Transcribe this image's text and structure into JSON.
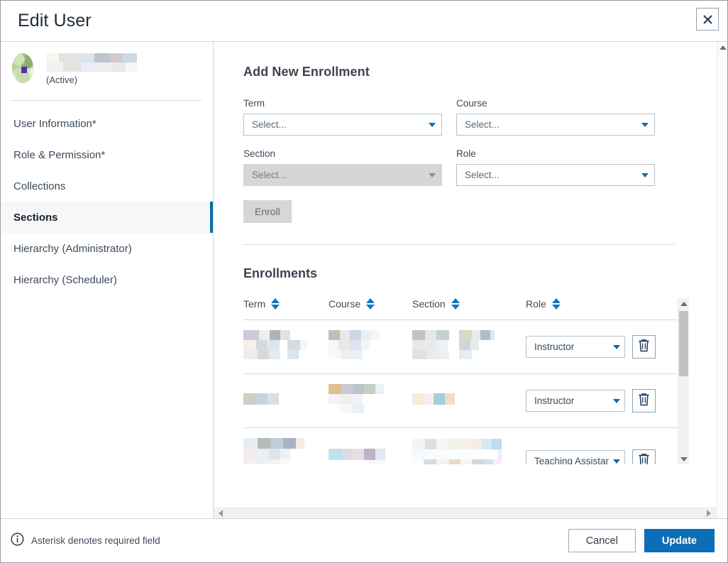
{
  "header": {
    "title": "Edit User",
    "close_label": "Close"
  },
  "sidebar": {
    "user": {
      "status": "(Active)",
      "name_redacted": true
    },
    "items": [
      {
        "label": "User Information*",
        "active": false
      },
      {
        "label": "Role & Permission*",
        "active": false
      },
      {
        "label": "Collections",
        "active": false
      },
      {
        "label": "Sections",
        "active": true
      },
      {
        "label": "Hierarchy (Administrator)",
        "active": false
      },
      {
        "label": "Hierarchy (Scheduler)",
        "active": false
      }
    ]
  },
  "main": {
    "add_enrollment": {
      "title": "Add New Enrollment",
      "fields": [
        {
          "label": "Term",
          "value": "Select...",
          "disabled": false
        },
        {
          "label": "Course",
          "value": "Select...",
          "disabled": false
        },
        {
          "label": "Section",
          "value": "Select...",
          "disabled": true
        },
        {
          "label": "Role",
          "value": "Select...",
          "disabled": false
        }
      ],
      "enroll_button": "Enroll"
    },
    "enrollments": {
      "title": "Enrollments",
      "columns": [
        {
          "label": "Term",
          "sortable": true
        },
        {
          "label": "Course",
          "sortable": true
        },
        {
          "label": "Section",
          "sortable": true
        },
        {
          "label": "Role",
          "sortable": true
        },
        {
          "label": "",
          "sortable": false
        }
      ],
      "rows": [
        {
          "term": "",
          "course": "",
          "section": "",
          "role": "Instructor",
          "redacted": true
        },
        {
          "term": "",
          "course": "",
          "section": "",
          "role": "Instructor",
          "redacted": true
        },
        {
          "term": "",
          "course": "",
          "section": "",
          "role": "Teaching Assistant",
          "redacted": true
        }
      ]
    }
  },
  "footer": {
    "note": "Asterisk denotes required field",
    "cancel_label": "Cancel",
    "update_label": "Update"
  },
  "colors": {
    "accent_blue": "#0d6eb8",
    "sort_blue": "#1277bc",
    "title_text": "#1d2b3a",
    "body_text": "#3d4b5a",
    "disabled_grey": "#d6d6d6",
    "border_grey": "#d6d6d6"
  }
}
